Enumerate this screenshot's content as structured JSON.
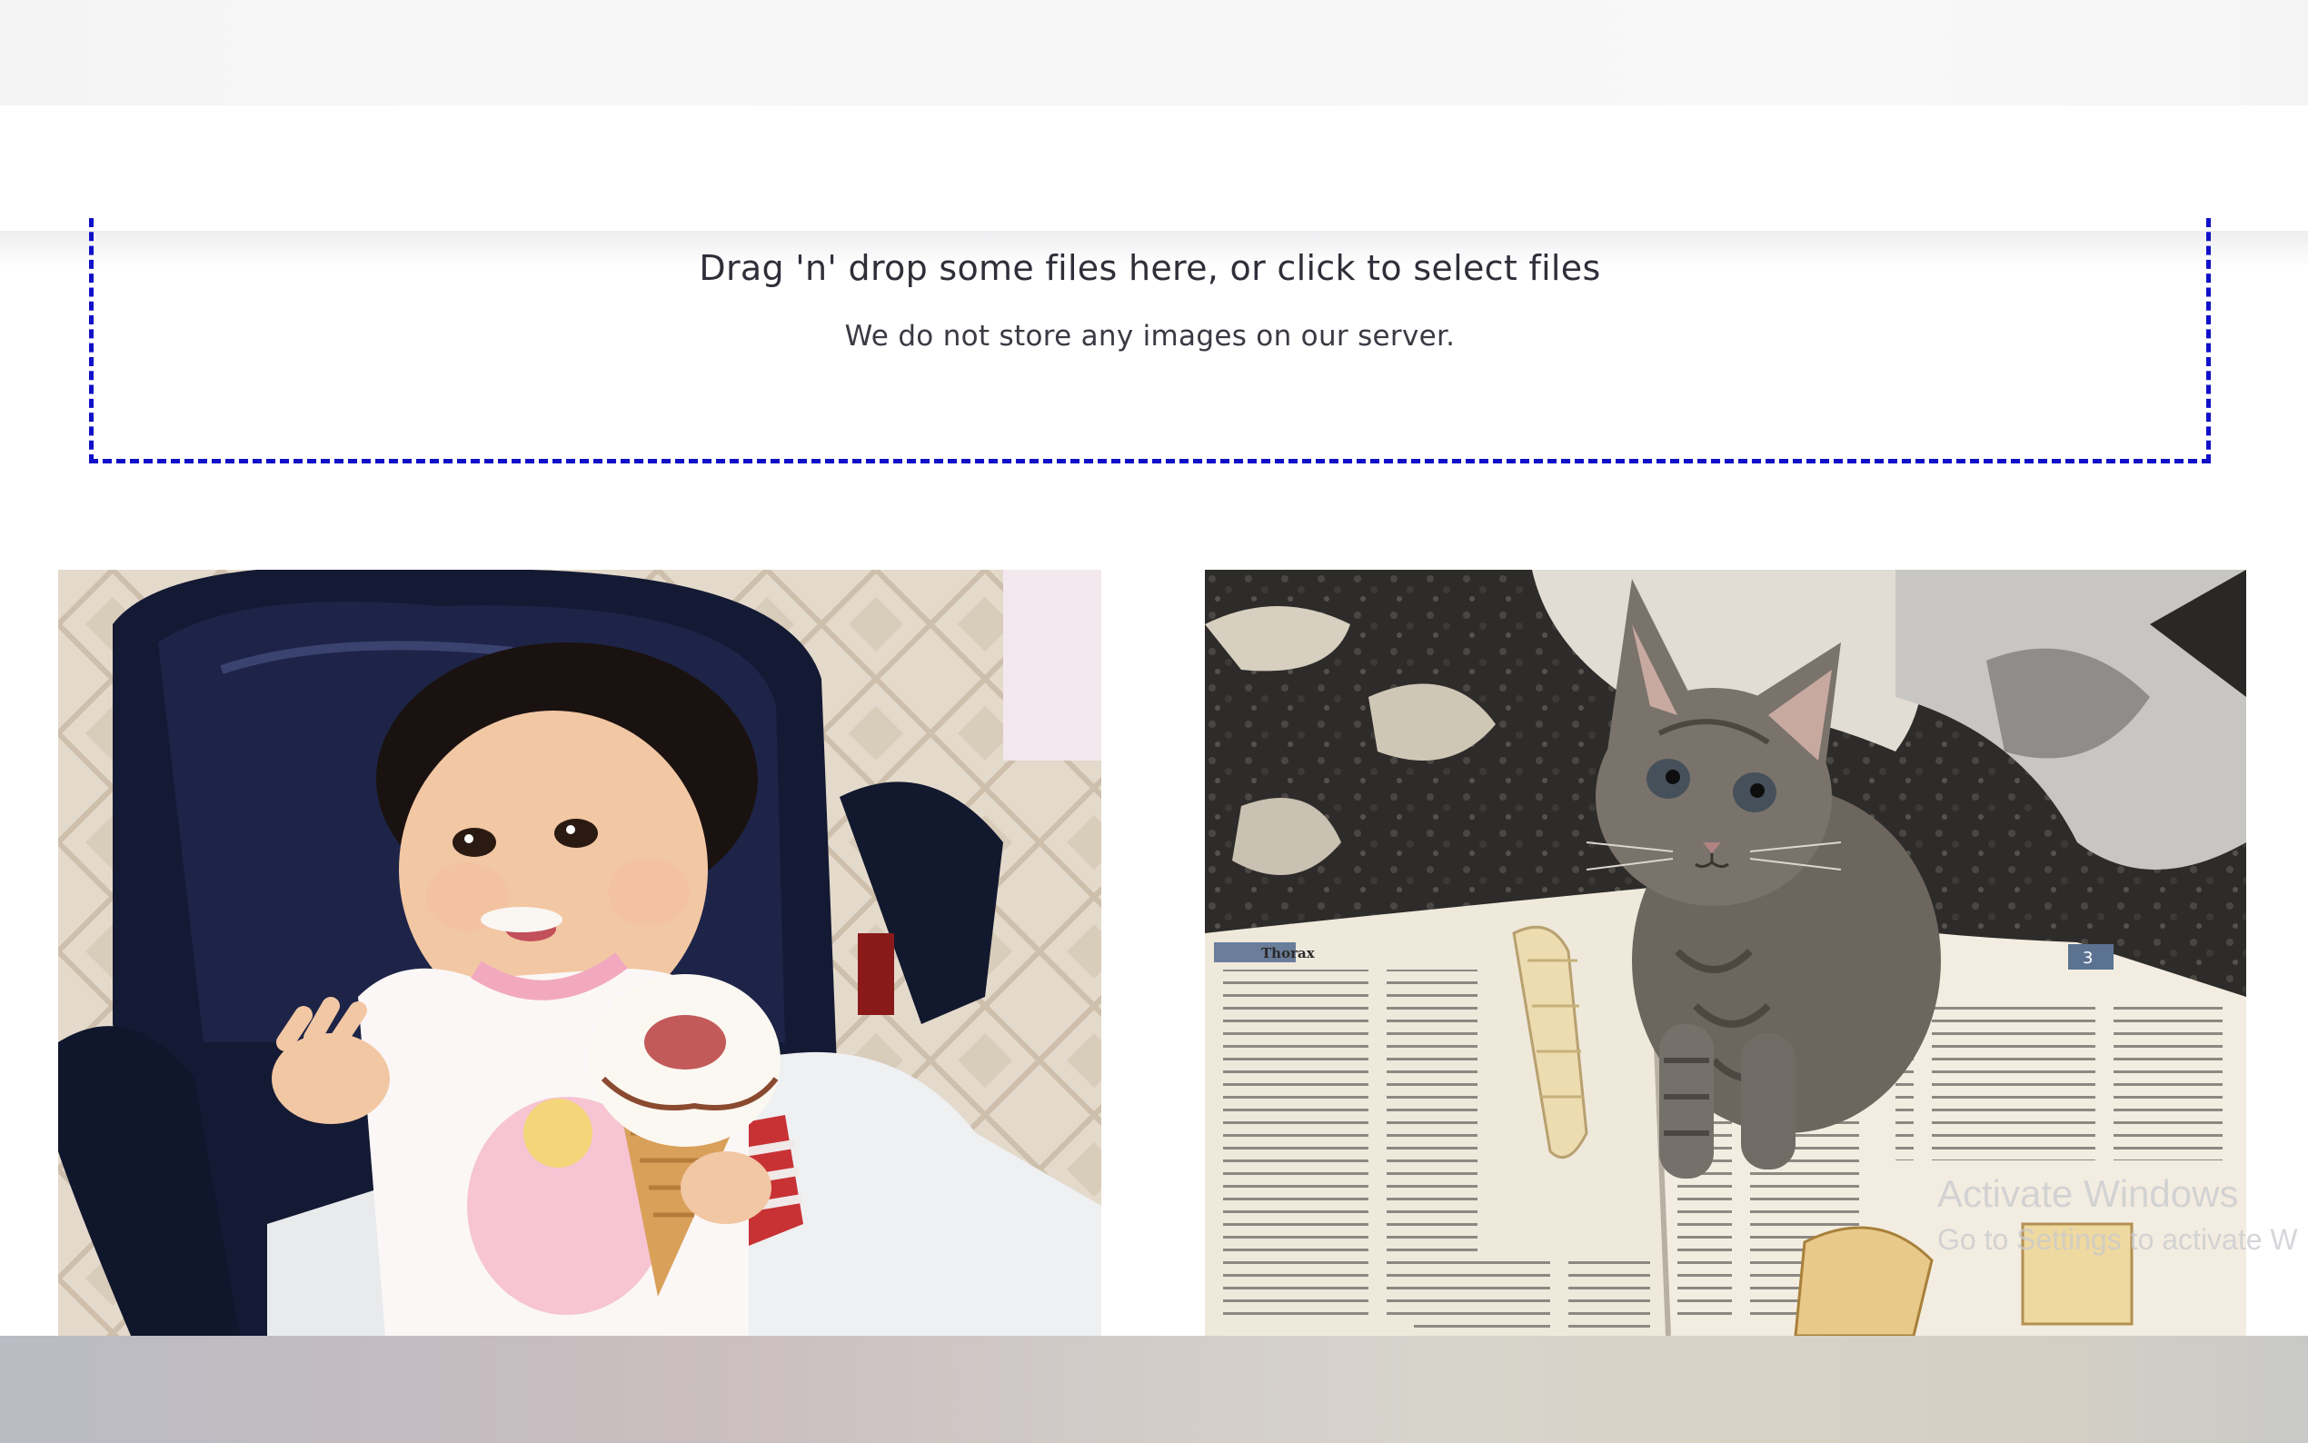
{
  "dropzone": {
    "title": "Drag 'n' drop some files here, or click to select files",
    "note": "We do not store any images on our server."
  },
  "photos": [
    {
      "name": "baby-with-ice-cream-photo"
    },
    {
      "name": "kitten-on-book-photo"
    }
  ],
  "book_page": {
    "heading": "Thorax",
    "page_number": "3"
  },
  "watermark": {
    "title": "Activate Windows",
    "subtitle": "Go to Settings to activate W"
  },
  "colors": {
    "dropzone_border": "#1010c8",
    "text": "#2f2f3a"
  }
}
